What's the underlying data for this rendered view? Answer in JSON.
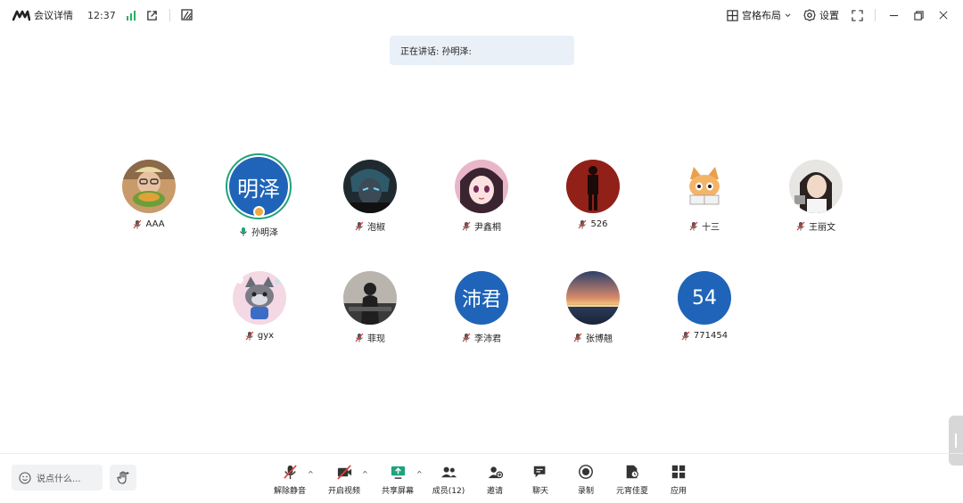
{
  "titlebar": {
    "meeting_info": "会议详情",
    "time": "12:37",
    "layout": "宫格布局",
    "settings": "设置"
  },
  "speaking": {
    "label": "正在讲话: 孙明泽:"
  },
  "participants": [
    {
      "name": "AAA",
      "avatar": "photo-person-food",
      "muted": true
    },
    {
      "name": "孙明泽",
      "avatar_text": "明泽",
      "host": true,
      "speaking": true
    },
    {
      "name": "泡椒",
      "avatar": "photo-anime-dark",
      "muted": true
    },
    {
      "name": "尹鑫桐",
      "avatar": "photo-anime-girl",
      "muted": true
    },
    {
      "name": "526",
      "avatar": "photo-red-silhouette",
      "muted": true
    },
    {
      "name": "十三",
      "avatar": "photo-cartoon-cat",
      "muted": true
    },
    {
      "name": "王丽文",
      "avatar": "photo-girl",
      "muted": true
    },
    {
      "name": "gyx",
      "avatar": "photo-cartoon-wolf",
      "muted": true
    },
    {
      "name": "菲现",
      "avatar": "photo-girl-dark",
      "muted": true
    },
    {
      "name": "李沛君",
      "avatar_text": "沛君",
      "muted": true
    },
    {
      "name": "张博翹",
      "avatar": "photo-sunset",
      "muted": true
    },
    {
      "name": "771454",
      "avatar_text": "54",
      "muted": true
    }
  ],
  "bottom": {
    "say_placeholder": "说点什么...",
    "tools": [
      {
        "label": "解除静音",
        "icon": "mic-off-icon"
      },
      {
        "label": "开启视频",
        "icon": "video-off-icon"
      },
      {
        "label": "共享屏幕",
        "icon": "share-screen-icon"
      },
      {
        "label": "成员(12)",
        "icon": "members-icon"
      },
      {
        "label": "邀请",
        "icon": "invite-icon"
      },
      {
        "label": "聊天",
        "icon": "chat-icon"
      },
      {
        "label": "录制",
        "icon": "record-icon"
      },
      {
        "label": "元宵佳夏",
        "icon": "app-icon"
      },
      {
        "label": "应用",
        "icon": "apps-grid-icon"
      }
    ]
  },
  "colors": {
    "accent": "#1f64b8",
    "speaking_ring": "#1ea37c",
    "signal": "#22b35e",
    "banner_bg": "#eaf0f8"
  }
}
